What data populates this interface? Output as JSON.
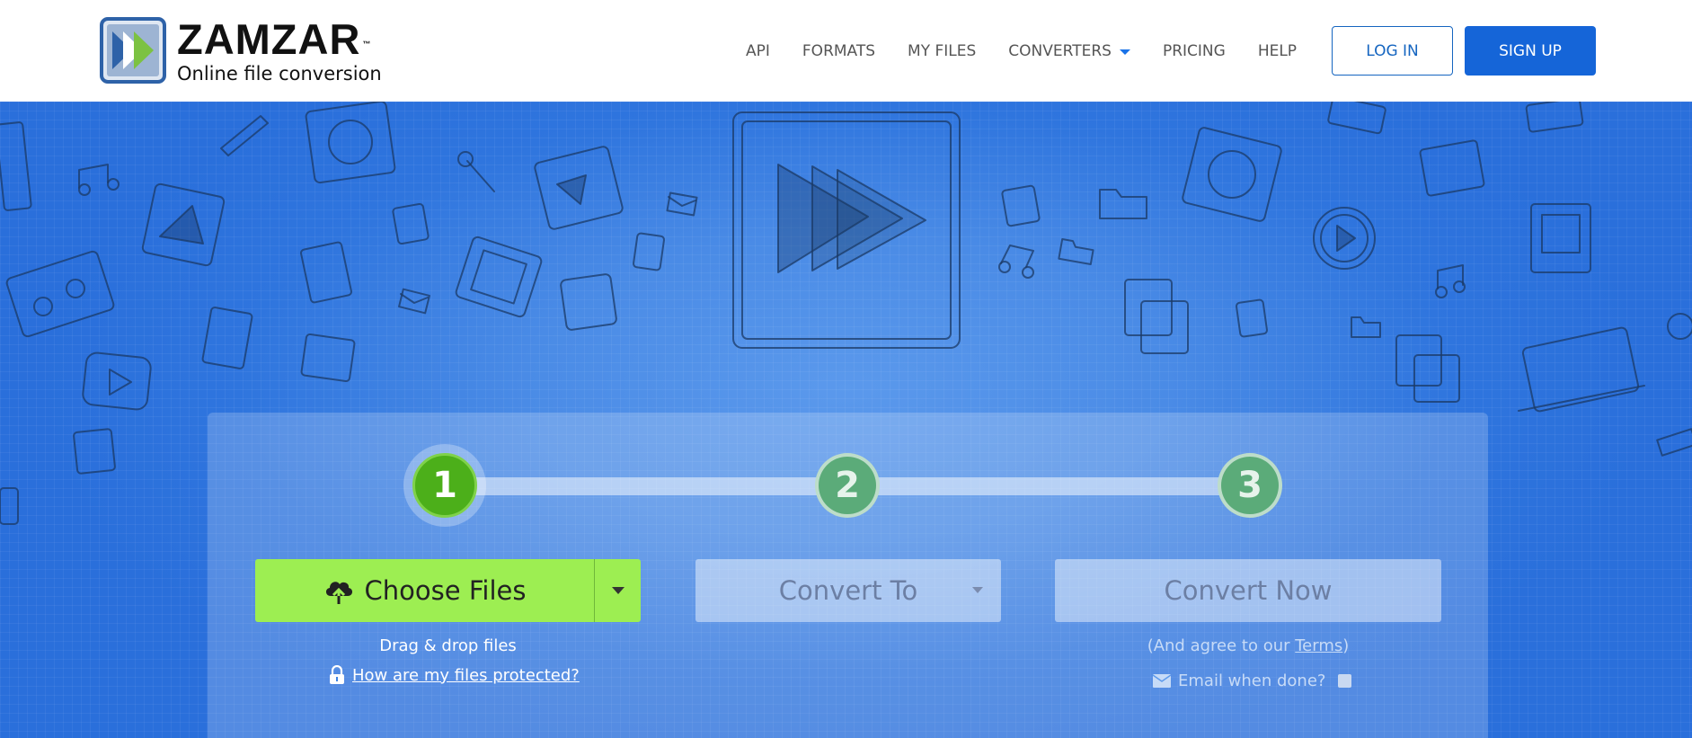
{
  "brand": {
    "name": "ZAMZAR",
    "trademark": "™",
    "tagline": "Online file conversion"
  },
  "nav": {
    "items": [
      {
        "label": "API"
      },
      {
        "label": "FORMATS"
      },
      {
        "label": "MY FILES"
      },
      {
        "label": "CONVERTERS",
        "has_dropdown": true
      },
      {
        "label": "PRICING"
      },
      {
        "label": "HELP"
      }
    ],
    "login_label": "LOG IN",
    "signup_label": "SIGN UP"
  },
  "steps": [
    {
      "number": "1",
      "state": "active"
    },
    {
      "number": "2",
      "state": "inactive"
    },
    {
      "number": "3",
      "state": "inactive"
    }
  ],
  "converter": {
    "choose_files_label": "Choose Files",
    "drag_drop_text": "Drag & drop files",
    "protection_link": "How are my files protected?",
    "convert_to_label": "Convert To",
    "convert_now_label": "Convert Now",
    "agree_prefix": "(And agree to our ",
    "terms_link": "Terms",
    "agree_suffix": ")",
    "email_label": "Email when done?",
    "email_checked": false
  },
  "colors": {
    "accent_blue": "#1565d8",
    "hero_blue": "#2f75de",
    "choose_green": "#9dee52",
    "step_active": "#4caf1a",
    "step_inactive": "#5bab79"
  }
}
